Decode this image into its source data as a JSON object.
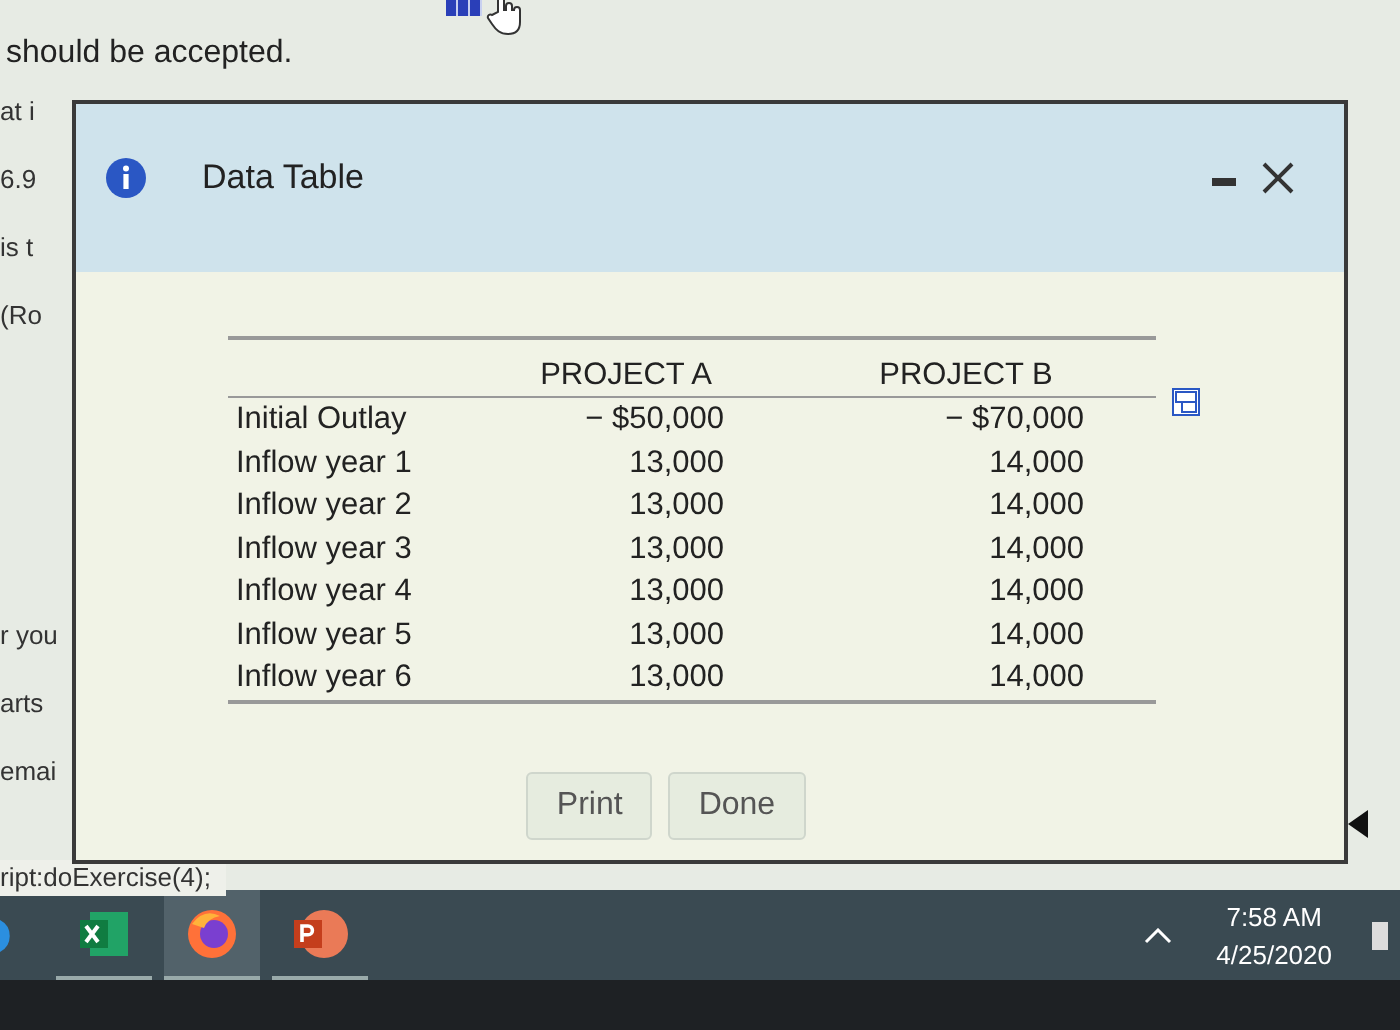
{
  "page": {
    "intro": "should be accepted.",
    "left_fragments": [
      "at i",
      "6.9",
      "is t",
      "(Ro",
      "r you",
      "arts",
      "emai"
    ],
    "status_text": "ript:doExercise(4);"
  },
  "dialog": {
    "title": "Data Table",
    "table": {
      "columns": [
        "PROJECT A",
        "PROJECT B"
      ],
      "rows": [
        {
          "label": "Initial Outlay",
          "values": [
            "− $50,000",
            "− $70,000"
          ]
        },
        {
          "label": "Inflow year 1",
          "values": [
            "13,000",
            "14,000"
          ]
        },
        {
          "label": "Inflow year 2",
          "values": [
            "13,000",
            "14,000"
          ]
        },
        {
          "label": "Inflow year 3",
          "values": [
            "13,000",
            "14,000"
          ]
        },
        {
          "label": "Inflow year 4",
          "values": [
            "13,000",
            "14,000"
          ]
        },
        {
          "label": "Inflow year 5",
          "values": [
            "13,000",
            "14,000"
          ]
        },
        {
          "label": "Inflow year 6",
          "values": [
            "13,000",
            "14,000"
          ]
        }
      ]
    },
    "buttons": [
      "Print",
      "Done"
    ]
  },
  "taskbar": {
    "apps": [
      {
        "kind": "excel",
        "selected": false
      },
      {
        "kind": "firefox",
        "selected": true
      },
      {
        "kind": "powerpoint",
        "selected": false
      }
    ],
    "time": "7:58 AM",
    "date": "4/25/2020"
  }
}
